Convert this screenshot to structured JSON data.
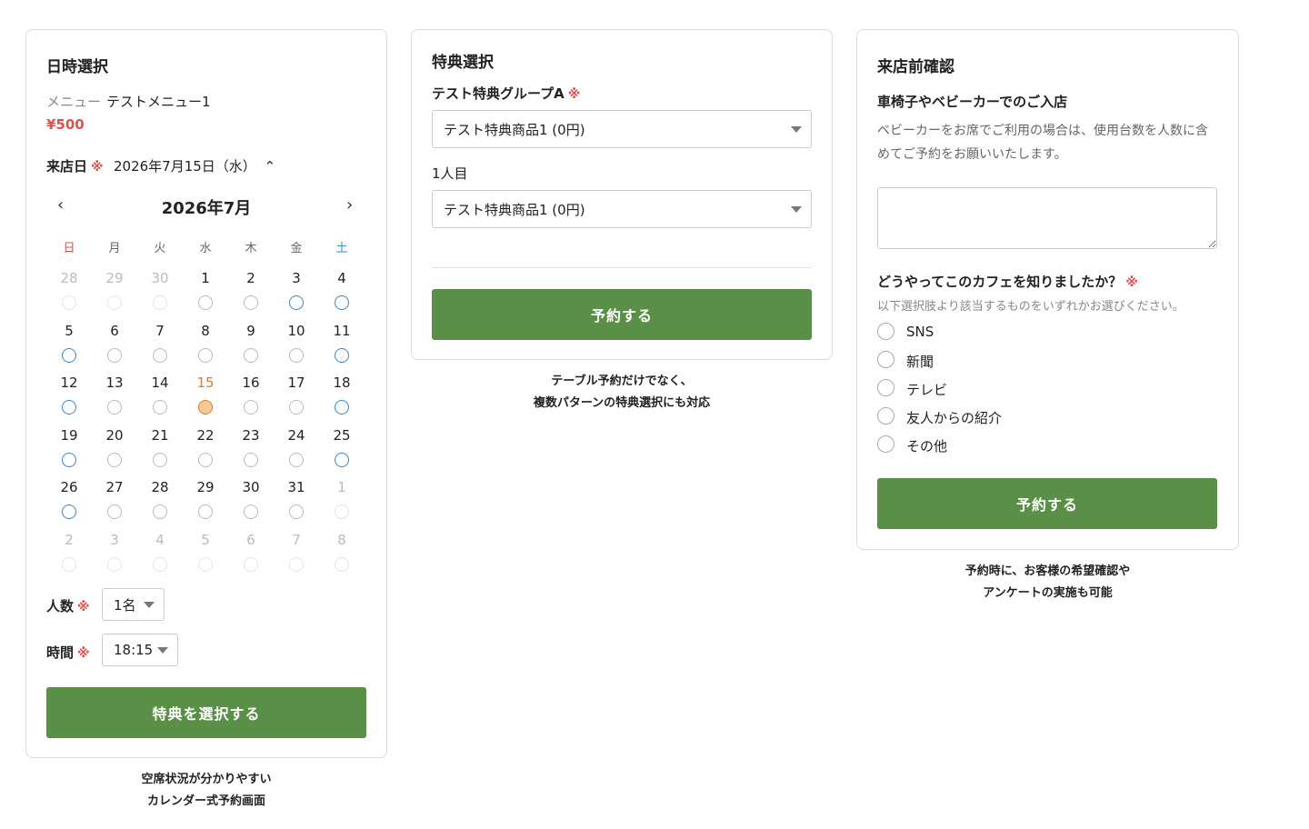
{
  "panel1": {
    "title": "日時選択",
    "menu_label": "メニュー",
    "menu_value": "テストメニュー1",
    "price": "¥500",
    "date_label": "来店日",
    "required_mark": "※",
    "date_value": "2026年7月15日（水）",
    "date_toggle": "⌃",
    "calendar": {
      "prev": "‹",
      "next": "›",
      "month": "2026年7月",
      "dow": [
        "日",
        "月",
        "火",
        "水",
        "木",
        "金",
        "土"
      ],
      "weeks": [
        [
          {
            "d": "28",
            "s": "muted"
          },
          {
            "d": "29",
            "s": "muted"
          },
          {
            "d": "30",
            "s": "muted"
          },
          {
            "d": "1",
            "s": "gray"
          },
          {
            "d": "2",
            "s": "gray"
          },
          {
            "d": "3",
            "s": "blue"
          },
          {
            "d": "4",
            "s": "blue"
          }
        ],
        [
          {
            "d": "5",
            "s": "blue"
          },
          {
            "d": "6",
            "s": "gray"
          },
          {
            "d": "7",
            "s": "gray"
          },
          {
            "d": "8",
            "s": "gray"
          },
          {
            "d": "9",
            "s": "gray"
          },
          {
            "d": "10",
            "s": "gray"
          },
          {
            "d": "11",
            "s": "blue"
          }
        ],
        [
          {
            "d": "12",
            "s": "blue"
          },
          {
            "d": "13",
            "s": "gray"
          },
          {
            "d": "14",
            "s": "gray"
          },
          {
            "d": "15",
            "s": "today"
          },
          {
            "d": "16",
            "s": "gray"
          },
          {
            "d": "17",
            "s": "gray"
          },
          {
            "d": "18",
            "s": "blue"
          }
        ],
        [
          {
            "d": "19",
            "s": "blue"
          },
          {
            "d": "20",
            "s": "gray"
          },
          {
            "d": "21",
            "s": "gray"
          },
          {
            "d": "22",
            "s": "gray"
          },
          {
            "d": "23",
            "s": "gray"
          },
          {
            "d": "24",
            "s": "gray"
          },
          {
            "d": "25",
            "s": "blue"
          }
        ],
        [
          {
            "d": "26",
            "s": "blue"
          },
          {
            "d": "27",
            "s": "gray"
          },
          {
            "d": "28",
            "s": "gray"
          },
          {
            "d": "29",
            "s": "gray"
          },
          {
            "d": "30",
            "s": "gray"
          },
          {
            "d": "31",
            "s": "gray"
          },
          {
            "d": "1",
            "s": "muted"
          }
        ],
        [
          {
            "d": "2",
            "s": "muted"
          },
          {
            "d": "3",
            "s": "muted"
          },
          {
            "d": "4",
            "s": "muted"
          },
          {
            "d": "5",
            "s": "muted"
          },
          {
            "d": "6",
            "s": "muted"
          },
          {
            "d": "7",
            "s": "muted"
          },
          {
            "d": "8",
            "s": "muted"
          }
        ]
      ]
    },
    "people_label": "人数",
    "people_value": "1名",
    "time_label": "時間",
    "time_value": "18:15",
    "button": "特典を選択する",
    "caption_line1": "空席状況が分かりやすい",
    "caption_line2": "カレンダー式予約画面"
  },
  "panel2": {
    "title": "特典選択",
    "group_label": "テスト特典グループA",
    "required_mark": "※",
    "group_value": "テスト特典商品1 (0円)",
    "person_label": "1人目",
    "person_value": "テスト特典商品1 (0円)",
    "button": "予約する",
    "caption_line1": "テーブル予約だけでなく、",
    "caption_line2": "複数パターンの特典選択にも対応"
  },
  "panel3": {
    "title": "来店前確認",
    "q1_title": "車椅子やベビーカーでのご入店",
    "q1_desc_line1": "ベビーカーをお席でご利用の場合は、使用台数を人数に含",
    "q1_desc_line2": "めてご予約をお願いいたします。",
    "q2_title": "どうやってこのカフェを知りましたか？",
    "required_mark": "※",
    "q2_desc": "以下選択肢より該当するものをいずれかお選びください。",
    "options": [
      "SNS",
      "新聞",
      "テレビ",
      "友人からの紹介",
      "その他"
    ],
    "button": "予約する",
    "caption_line1": "予約時に、お客様の希望確認や",
    "caption_line2": "アンケートの実施も可能"
  }
}
